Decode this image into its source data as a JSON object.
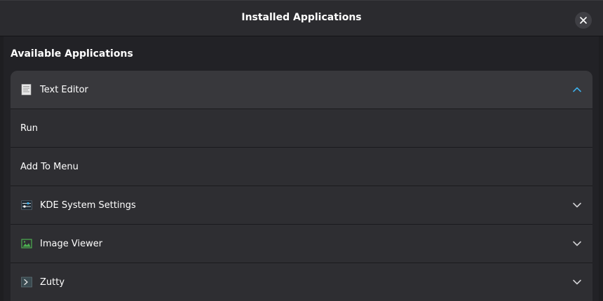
{
  "window": {
    "title": "Installed Applications"
  },
  "section": {
    "heading": "Available Applications"
  },
  "apps": {
    "text_editor": {
      "label": "Text Editor",
      "icon": "text-editor-icon"
    },
    "actions": [
      {
        "label": "Run"
      },
      {
        "label": "Add To Menu"
      }
    ],
    "kde_settings": {
      "label": "KDE System Settings",
      "icon": "settings-icon"
    },
    "image_viewer": {
      "label": "Image Viewer",
      "icon": "image-viewer-icon"
    },
    "zutty": {
      "label": "Zutty",
      "icon": "terminal-icon"
    }
  },
  "colors": {
    "accent": "#3daee9",
    "background": "#1e1e21",
    "row": "#2e2e32",
    "row_expanded": "#38383c"
  }
}
